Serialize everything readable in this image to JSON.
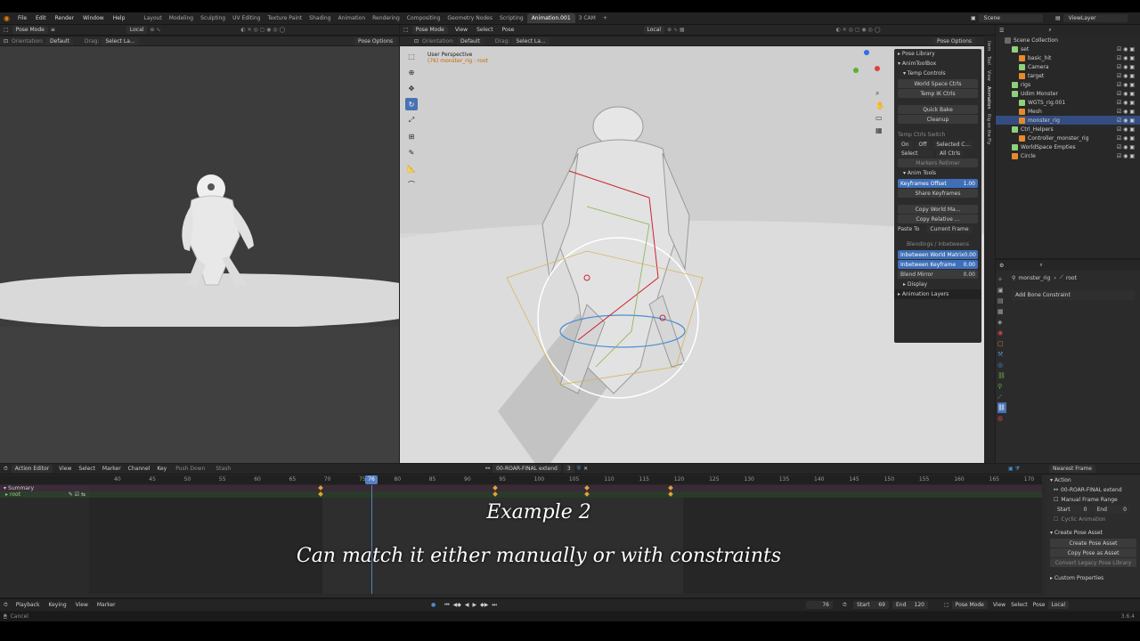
{
  "menu": [
    "File",
    "Edit",
    "Render",
    "Window",
    "Help"
  ],
  "workspaces": [
    "Layout",
    "Modeling",
    "Sculpting",
    "UV Editing",
    "Texture Paint",
    "Shading",
    "Animation",
    "Rendering",
    "Compositing",
    "Geometry Nodes",
    "Scripting",
    "Animation.001",
    "3 CAM"
  ],
  "active_workspace": "Animation.001",
  "scene_name": "Scene",
  "view_layer": "ViewLayer",
  "left_view": {
    "mode": "Pose Mode",
    "transform_space": "Local",
    "orientation_label": "Orientation:",
    "orientation_value": "Default",
    "drag_label": "Drag:",
    "drag_value": "Select La...",
    "pose_options": "Pose Options"
  },
  "main_view": {
    "mode": "Pose Mode",
    "menus": [
      "View",
      "Select",
      "Pose"
    ],
    "transform_space": "Local",
    "orientation_label": "Orientation:",
    "orientation_value": "Default",
    "drag_label": "Drag:",
    "drag_value": "Select La...",
    "pose_options": "Pose Options",
    "perspective": "User Perspective",
    "object_info": "(76) monster_rig : root"
  },
  "npanel": {
    "pose_library": "Pose Library",
    "anim_toolbox": "AnimToolBox",
    "temp_controls": "Temp Controls",
    "world_space_ctrls": "World Space Ctrls",
    "temp_ik_ctrls": "Temp IK Ctrls",
    "quick_bake": "Quick Bake",
    "cleanup": "Cleanup",
    "temp_ctrls_switch": "Temp Ctrls Switch",
    "on": "On",
    "off": "Off",
    "selected_c": "Selected C...",
    "select": "Select",
    "all_ctrls": "All Ctrls",
    "markers_retimer": "Markers Retimer",
    "anim_tools": "Anim Tools",
    "keyframes_offset": "Keyframes Offset",
    "keyframes_offset_value": "1.00",
    "share_keyframes": "Share Keyframes",
    "copy_world_ma": "Copy World Ma...",
    "copy_relative": "Copy Relative ...",
    "paste_to": "Paste To",
    "current_frame": "Current Frame",
    "blendings": "Blendings / Inbetweens",
    "inbetween_world_matrix": "Inbetween World Matrix",
    "inbetween_world_matrix_value": "0.00",
    "inbetween_keyframe": "Inbetween Keyframe",
    "inbetween_keyframe_value": "0.00",
    "blend_mirror": "Blend Mirror",
    "blend_mirror_value": "0.00",
    "display": "Display",
    "animation_layers": "Animation Layers"
  },
  "side_tabs": [
    "Item",
    "Tool",
    "View",
    "Animation",
    "Rig on the Fly"
  ],
  "outliner": {
    "root": "Scene Collection",
    "items": [
      {
        "label": "set",
        "indent": 1
      },
      {
        "label": "basic_hit",
        "indent": 2
      },
      {
        "label": "Camera",
        "indent": 2
      },
      {
        "label": "target",
        "indent": 2
      },
      {
        "label": "rigs",
        "indent": 1
      },
      {
        "label": "Udim Monster",
        "indent": 1
      },
      {
        "label": "WGTS_rig.001",
        "indent": 2
      },
      {
        "label": "Mesh",
        "indent": 2
      },
      {
        "label": "monster_rig",
        "indent": 2
      },
      {
        "label": "Ctrl_Helpers",
        "indent": 1
      },
      {
        "label": "Controller_monster_rig",
        "indent": 2
      },
      {
        "label": "WorldSpace Empties",
        "indent": 1
      },
      {
        "label": "Circle",
        "indent": 1
      }
    ]
  },
  "properties": {
    "object": "monster_rig",
    "bone": "root",
    "add_bone_constraint": "Add Bone Constraint"
  },
  "action_editor": {
    "editor_label": "Action Editor",
    "menus": [
      "View",
      "Select",
      "Marker",
      "Channel",
      "Key"
    ],
    "push_down": "Push Down",
    "stash": "Stash",
    "action_name": "00-ROAR-FINAL extend",
    "action_users": "3",
    "snapping": "Nearest Frame",
    "current_frame_marker": "76",
    "ruler_ticks": [
      "40",
      "45",
      "50",
      "55",
      "60",
      "65",
      "70",
      "75",
      "80",
      "85",
      "90",
      "95",
      "100",
      "105",
      "110",
      "115",
      "120",
      "125",
      "130",
      "135",
      "140",
      "145",
      "150",
      "155",
      "160",
      "165",
      "170"
    ],
    "channels": [
      "Summary",
      "root"
    ],
    "keyframes": [
      69,
      94,
      107,
      119
    ]
  },
  "action_panel": {
    "title": "Action",
    "action_name": "00-ROAR-FINAL extend",
    "manual_frame_range": "Manual Frame Range",
    "start": "Start",
    "end": "End",
    "start_value": "0",
    "end_value": "0",
    "cyclic": "Cyclic Animation",
    "create_pose_asset_header": "Create Pose Asset",
    "create_pose_asset": "Create Pose Asset",
    "copy_pose_as_asset": "Copy Pose as Asset",
    "convert_legacy": "Convert Legacy Pose Library",
    "custom_properties": "Custom Properties"
  },
  "caption": {
    "line1": "Example 2",
    "line2": "Can match it either manually or with constraints"
  },
  "playback": {
    "menus": [
      "Playback",
      "Keying",
      "View",
      "Marker"
    ],
    "current_frame": "76",
    "start_label": "Start",
    "start": "69",
    "end_label": "End",
    "end": "120"
  },
  "status": {
    "left": "Cancel",
    "mode": "Pose Mode",
    "menus": [
      "View",
      "Select",
      "Pose"
    ],
    "space": "Local",
    "version": "3.6.4"
  },
  "colors": {
    "accent_blue": "#4772b3",
    "keyframe": "#e0a33a",
    "playhead": "#5680c2"
  }
}
